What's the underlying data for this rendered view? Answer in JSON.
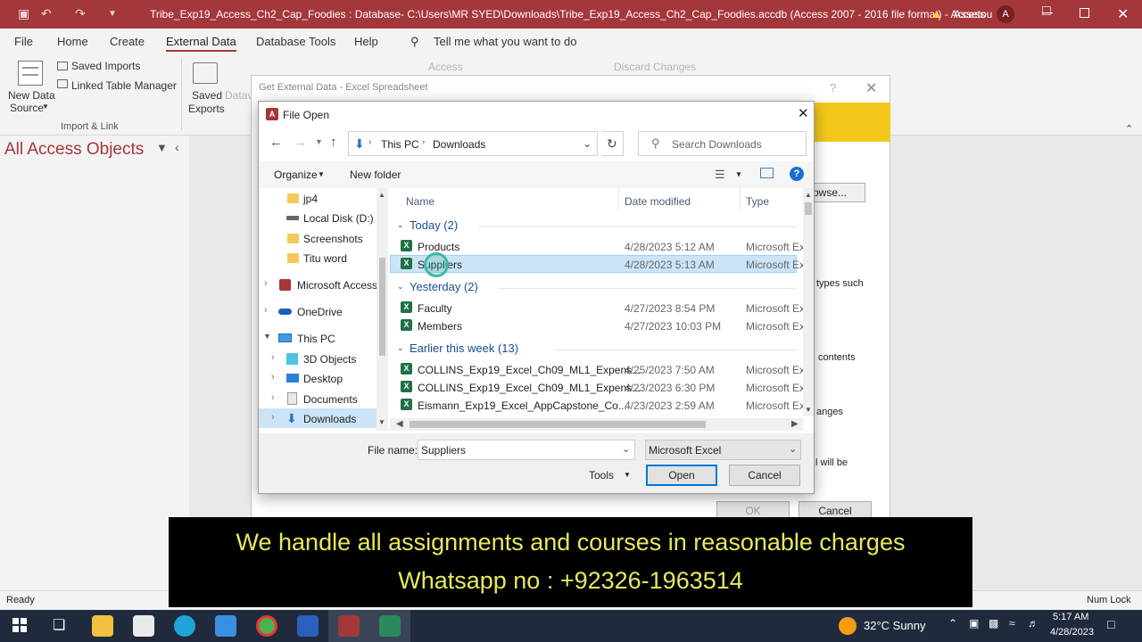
{
  "window": {
    "title": "Tribe_Exp19_Access_Ch2_Cap_Foodies : Database- C:\\Users\\MR SYED\\Downloads\\Tribe_Exp19_Access_Ch2_Cap_Foodies.accdb (Access 2007 - 2016 file format)  -  Access",
    "user": "Assetou",
    "avatar": "A"
  },
  "menu": [
    "File",
    "Home",
    "Create",
    "External Data",
    "Database Tools",
    "Help"
  ],
  "tell_me": "Tell me what you want to do",
  "ribbon": {
    "new_data_source_1": "New Data",
    "new_data_source_2": "Source",
    "saved_imports": "Saved Imports",
    "linked_table_manager": "Linked Table Manager",
    "import_link": "Import & Link",
    "saved_exports_1": "Saved",
    "saved_exports_2": "Exports",
    "datav": "Datav",
    "access": "Access",
    "discard_changes": "Discard Changes"
  },
  "nav": {
    "title": "All Access Objects"
  },
  "wizard": {
    "title": "Get External Data - Excel Spreadsheet",
    "browse": "owse...",
    "text1": "types such",
    "text2": "contents",
    "text3": "anges",
    "text4": "l will be",
    "ok": "OK",
    "cancel": "Cancel"
  },
  "dialog": {
    "title": "File Open",
    "breadcrumb_root": "This PC",
    "breadcrumb_folder": "Downloads",
    "search_placeholder": "Search Downloads",
    "organize": "Organize",
    "new_folder": "New folder",
    "columns": {
      "name": "Name",
      "date": "Date modified",
      "type": "Type"
    },
    "tree": [
      {
        "label": "jp4",
        "icon": "folder-icon"
      },
      {
        "label": "Local Disk (D:)",
        "icon": "drive-icon"
      },
      {
        "label": "Screenshots",
        "icon": "folder-icon"
      },
      {
        "label": "Titu word",
        "icon": "folder-icon"
      },
      {
        "label": "Microsoft Access",
        "icon": "access-icon"
      },
      {
        "label": "OneDrive",
        "icon": "cloud-icon"
      },
      {
        "label": "This PC",
        "icon": "pc-icon"
      },
      {
        "label": "3D Objects",
        "icon": "cube-icon"
      },
      {
        "label": "Desktop",
        "icon": "desktop-icon"
      },
      {
        "label": "Documents",
        "icon": "document-icon"
      },
      {
        "label": "Downloads",
        "icon": "download-icon"
      }
    ],
    "groups": [
      {
        "label": "Today (2)",
        "files": [
          {
            "name": "Products",
            "date": "4/28/2023 5:12 AM",
            "type": "Microsoft Ex"
          },
          {
            "name": "Suppliers",
            "date": "4/28/2023 5:13 AM",
            "type": "Microsoft Ex"
          }
        ]
      },
      {
        "label": "Yesterday (2)",
        "files": [
          {
            "name": "Faculty",
            "date": "4/27/2023 8:54 PM",
            "type": "Microsoft Ex"
          },
          {
            "name": "Members",
            "date": "4/27/2023 10:03 PM",
            "type": "Microsoft Ex"
          }
        ]
      },
      {
        "label": "Earlier this week (13)",
        "files": [
          {
            "name": "COLLINS_Exp19_Excel_Ch09_ML1_Expens...",
            "date": "4/25/2023 7:50 AM",
            "type": "Microsoft Ex"
          },
          {
            "name": "COLLINS_Exp19_Excel_Ch09_ML1_Expens...",
            "date": "4/23/2023 6:30 PM",
            "type": "Microsoft Ex"
          },
          {
            "name": "Eismann_Exp19_Excel_AppCapstone_Co...",
            "date": "4/23/2023 2:59 AM",
            "type": "Microsoft Ex"
          }
        ]
      }
    ],
    "filename_label": "File name:",
    "filename_value": "Suppliers",
    "filetype": "Microsoft Excel",
    "tools": "Tools",
    "open": "Open",
    "cancel": "Cancel"
  },
  "status": {
    "left": "Ready",
    "right": "Num Lock"
  },
  "overlay": {
    "line1": "We handle all assignments and courses in reasonable charges",
    "line2": "Whatsapp no : +92326-1963514"
  },
  "taskbar": {
    "weather": "32°C  Sunny",
    "time": "5:17 AM",
    "date": "4/28/2023"
  }
}
